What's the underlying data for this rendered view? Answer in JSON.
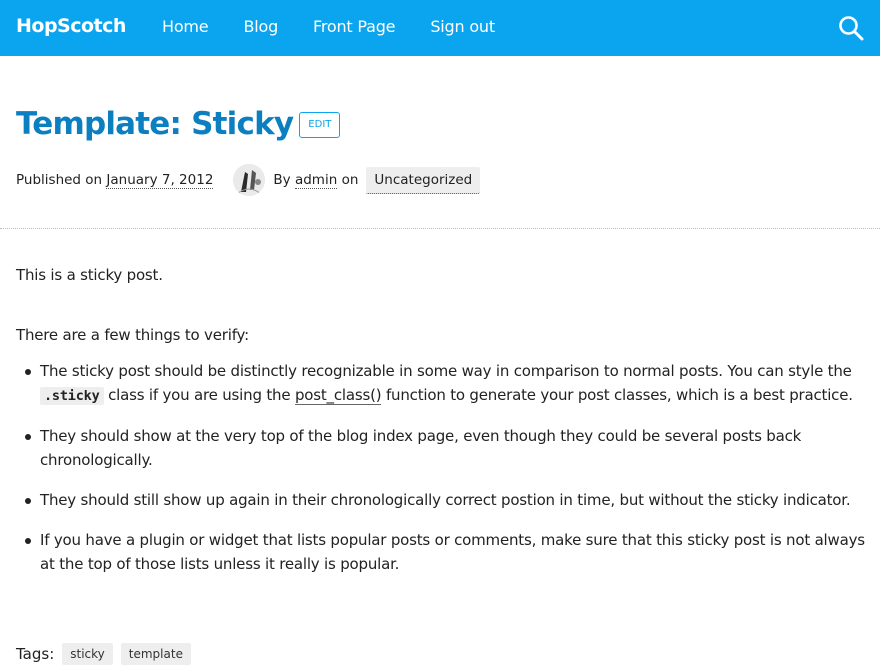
{
  "header": {
    "brand": "HopScotch",
    "nav": [
      "Home",
      "Blog",
      "Front Page",
      "Sign out"
    ],
    "search_icon": "search-icon"
  },
  "post": {
    "title": "Template: Sticky",
    "edit_label": "EDIT",
    "meta": {
      "published_prefix": "Published on",
      "date": "January 7, 2012",
      "by": "By",
      "author": "admin",
      "on": "on",
      "category": "Uncategorized"
    },
    "intro": "This is a sticky post.",
    "verify_heading": "There are a few things to verify:",
    "bullets": {
      "b1_a": "The sticky post should be distinctly recognizable in some way in comparison to normal posts. You can style the",
      "b1_code": ".sticky",
      "b1_b": "class if you are using the",
      "b1_link": "post_class()",
      "b1_c": "function to generate your post classes, which is a best practice.",
      "b2": "They should show at the very top of the blog index page, even though they could be several posts back chronologically.",
      "b3": "They should still show up again in their chronologically correct postion in time, but without the sticky indicator.",
      "b4": "If you have a plugin or widget that lists popular posts or comments, make sure that this sticky post is not always at the top of those lists unless it really is popular."
    },
    "tags_label": "Tags:",
    "tags": [
      "sticky",
      "template"
    ]
  },
  "colors": {
    "header_bg": "#0aa5ee",
    "title": "#0c7fc1"
  }
}
